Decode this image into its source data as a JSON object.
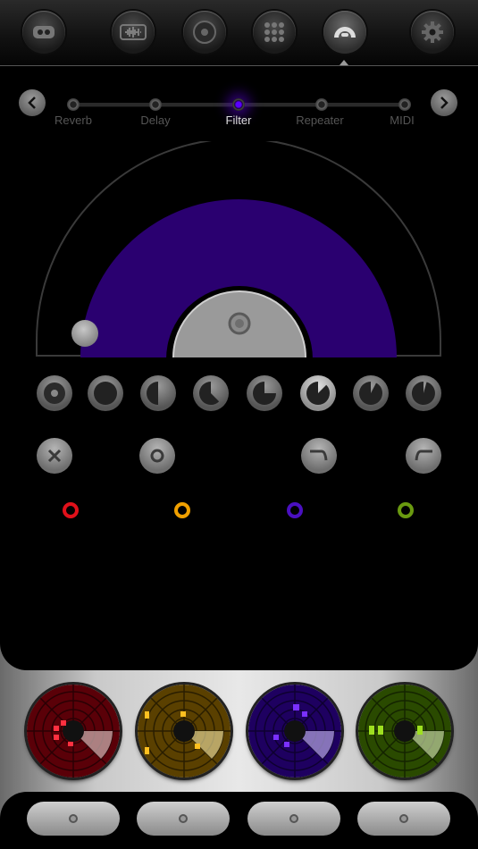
{
  "toolbar": {
    "buttons": [
      {
        "icon": "face-icon",
        "active": false
      },
      {
        "icon": "waveform-icon",
        "active": false
      },
      {
        "icon": "record-icon",
        "active": false
      },
      {
        "icon": "grid-icon",
        "active": false
      },
      {
        "icon": "fx-knob-icon",
        "active": true
      },
      {
        "icon": "gear-icon",
        "active": false
      }
    ]
  },
  "effects": {
    "prev_icon": "chevron-left-icon",
    "next_icon": "chevron-right-icon",
    "items": [
      "Reverb",
      "Delay",
      "Filter",
      "Repeater",
      "MIDI"
    ],
    "selected": "Filter"
  },
  "colors": {
    "filter_arc": "#2a0070",
    "accent_purple": "#5a00ff",
    "red": "#e0101a",
    "orange": "#f0a000",
    "purple": "#4a10c0",
    "green": "#6a9a10"
  },
  "shape_buttons": [
    "ring-icon",
    "full-circle-icon",
    "half-circle-icon",
    "pie-five-eighths-icon",
    "pie-three-quarters-icon",
    "pie-quarter-icon",
    "pie-eighth-icon",
    "pie-sliver-icon"
  ],
  "filter_types": [
    "close-icon",
    "ring-icon",
    "lowpass-icon",
    "highpass-icon"
  ],
  "channels": [
    "red",
    "orange",
    "purple",
    "green"
  ],
  "pads": [
    "red-pad",
    "orange-pad",
    "purple-pad",
    "green-pad"
  ],
  "bottom_buttons": 4
}
